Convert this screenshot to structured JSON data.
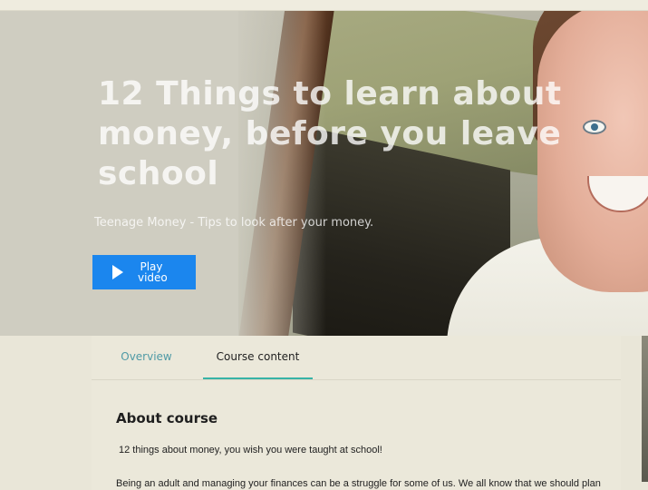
{
  "hero": {
    "title": "12 Things to learn about money, before you leave school",
    "subtitle": "Teenage Money - Tips to  look after your money.",
    "play_label": "Play\nvideo"
  },
  "tabs": [
    {
      "label": "Overview",
      "active": false
    },
    {
      "label": "Course content",
      "active": true
    }
  ],
  "about": {
    "heading": "About course",
    "line1": "12 things about money, you wish you were taught at school!",
    "line2": "Being an adult and managing your finances can be a struggle for some of us. We all know that we should plan"
  },
  "colors": {
    "accent": "#1b86ee",
    "tab_underline": "#37b3a6",
    "background": "#e9e6d8"
  },
  "icons": [
    "play-icon"
  ]
}
